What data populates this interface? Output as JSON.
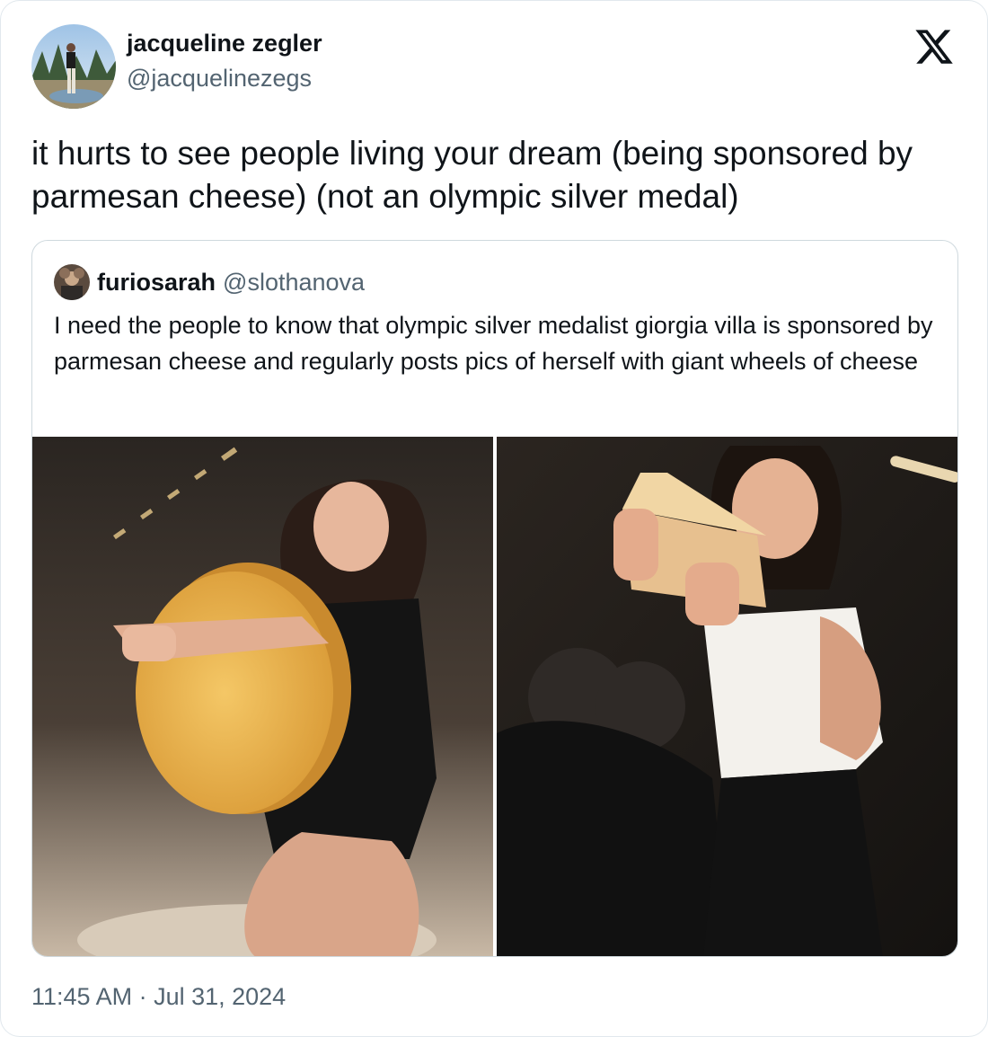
{
  "author": {
    "display_name": "jacqueline zegler",
    "handle": "@jacquelinezegs",
    "avatar_icon": "profile-photo"
  },
  "logo": {
    "icon": "x-logo-icon"
  },
  "tweet": {
    "text": "it hurts to see people living your dream (being sponsored by parmesan cheese) (not an olympic silver medal)"
  },
  "quoted_tweet": {
    "display_name": "furiosarah",
    "handle": "@slothanova",
    "text": "I need the people to know that olympic silver medalist giorgia villa is sponsored by parmesan cheese and regularly posts pics of herself with giant wheels of cheese",
    "media": [
      {
        "icon": "photo-gymnast-cheese-wheel"
      },
      {
        "icon": "photo-gymnast-cheese-wedge"
      }
    ]
  },
  "timestamp": "11:45 AM · Jul 31, 2024",
  "colors": {
    "text": "#0f1419",
    "secondary": "#536471",
    "border": "#cfd9de"
  }
}
